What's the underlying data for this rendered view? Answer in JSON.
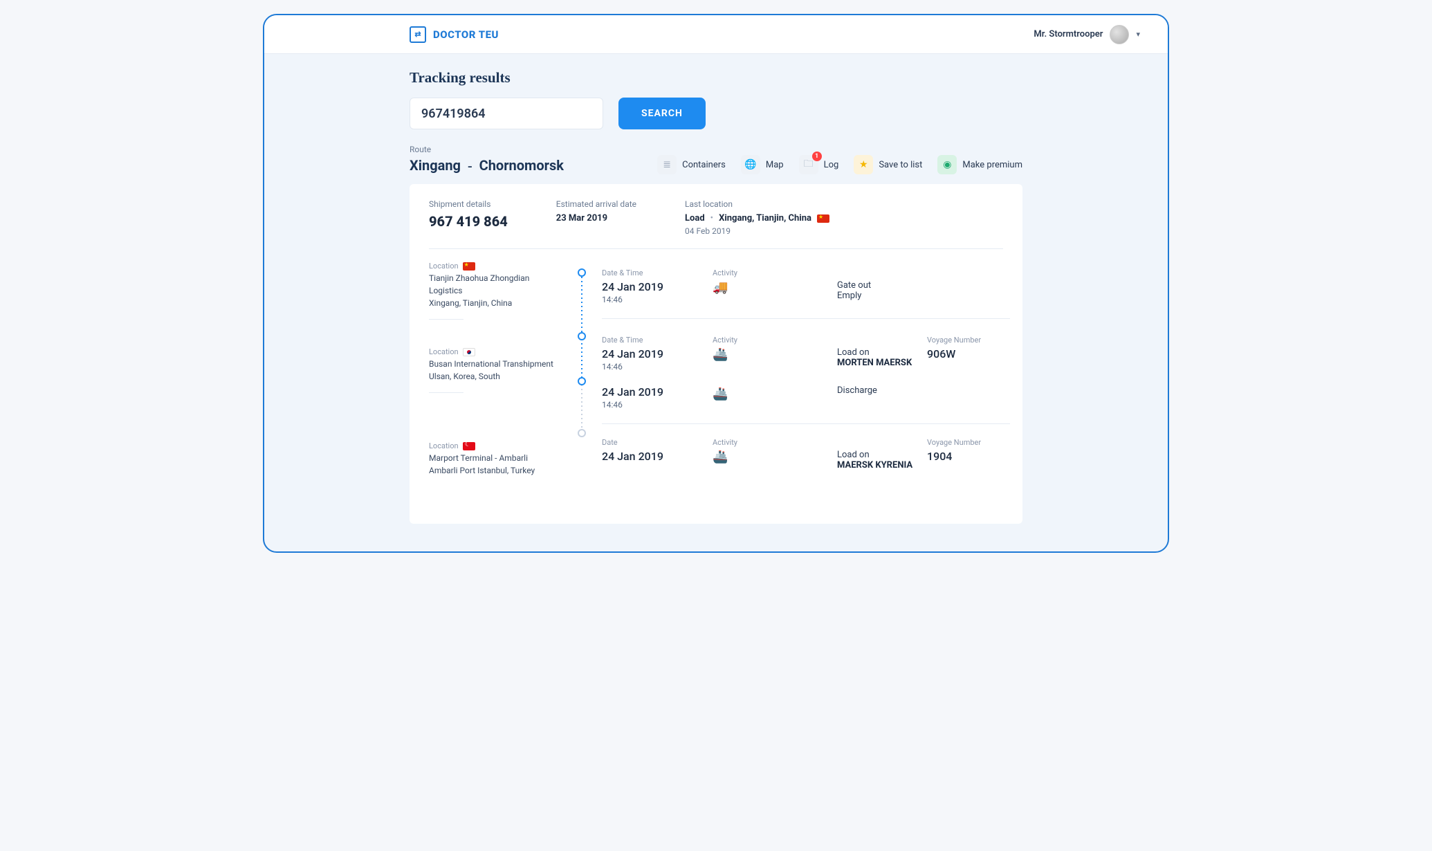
{
  "brand": "DOCTOR TEU",
  "user": {
    "name": "Mr. Stormtrooper"
  },
  "page_title": "Tracking results",
  "search": {
    "value": "967419864",
    "button": "SEARCH"
  },
  "route": {
    "label": "Route",
    "from": "Xingang",
    "to": "Chornomorsk"
  },
  "actions": {
    "containers": "Containers",
    "map": "Map",
    "log": "Log",
    "log_badge": "1",
    "save": "Save to list",
    "premium": "Make premium"
  },
  "summary": {
    "details_label": "Shipment details",
    "shipment_no": "967 419 864",
    "eta_label": "Estimated arrival date",
    "eta": "23 Mar 2019",
    "last_label": "Last location",
    "last_activity": "Load",
    "last_place": "Xingang, Tianjin, China",
    "last_date": "04 Feb 2019"
  },
  "labels": {
    "location": "Location",
    "datetime": "Date & Time",
    "date": "Date",
    "activity": "Activity",
    "voyage": "Voyage Number"
  },
  "locations": [
    {
      "flag": "cn",
      "name": "Tianjin Zhaohua Zhongdian Logistics",
      "sub": "Xingang, Tianjin, China"
    },
    {
      "flag": "kr",
      "name": "Busan International Transhipment",
      "sub": "Ulsan, Korea, South"
    },
    {
      "flag": "tr",
      "name": "Marport Terminal - Ambarli",
      "sub": "Ambarli Port Istanbul, Turkey"
    }
  ],
  "events": [
    {
      "date": "24 Jan 2019",
      "time": "14:46",
      "icon": "truck",
      "act1": "Gate out",
      "act2": "Emply"
    },
    {
      "date": "24 Jan 2019",
      "time": "14:46",
      "icon": "ship",
      "act1": "Load on",
      "vessel": "MORTEN MAERSK",
      "voyage": "906W"
    },
    {
      "date": "24 Jan 2019",
      "time": "14:46",
      "icon": "ship",
      "act1": "Discharge"
    },
    {
      "date": "24 Jan 2019",
      "icon": "ship",
      "act1": "Load on",
      "vessel": "MAERSK KYRENIA",
      "voyage": "1904"
    }
  ]
}
